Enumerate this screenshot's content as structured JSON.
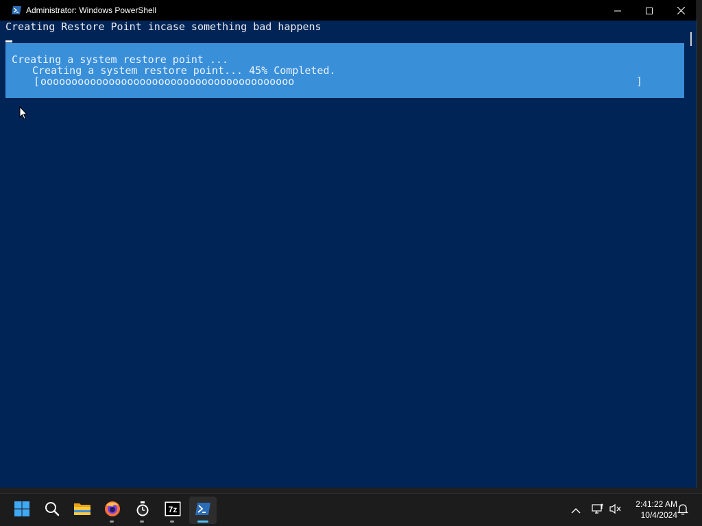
{
  "window": {
    "title": "Administrator: Windows PowerShell",
    "icon": "powershell-icon",
    "controls": [
      "minimize-icon",
      "maximize-icon",
      "close-icon"
    ]
  },
  "console": {
    "lines": [
      "Creating Restore Point incase something bad happens"
    ],
    "progress": {
      "activity": "Creating a system restore point ...",
      "status": "Creating a system restore point... 45% Completed.",
      "bar_open": "[",
      "bar_fill": "ooooooooooooooooooooooooooooooooooooooooo",
      "bar_close": "]",
      "percent": 45
    },
    "background": "#012456",
    "progress_background": "#3a8fd9"
  },
  "taskbar": {
    "icons": [
      {
        "name": "start-icon"
      },
      {
        "name": "search-icon"
      },
      {
        "name": "file-explorer-icon"
      },
      {
        "name": "firefox-icon"
      },
      {
        "name": "stopwatch-icon"
      },
      {
        "name": "7zip-icon",
        "label": "7z"
      },
      {
        "name": "powershell-icon"
      }
    ],
    "tray": {
      "chevron": "chevron-up-icon",
      "network": "network-icon",
      "volume": "volume-muted-icon",
      "notifications": "notification-bell-icon"
    },
    "clock": {
      "time": "2:41:22 AM",
      "date": "10/4/2024"
    }
  }
}
